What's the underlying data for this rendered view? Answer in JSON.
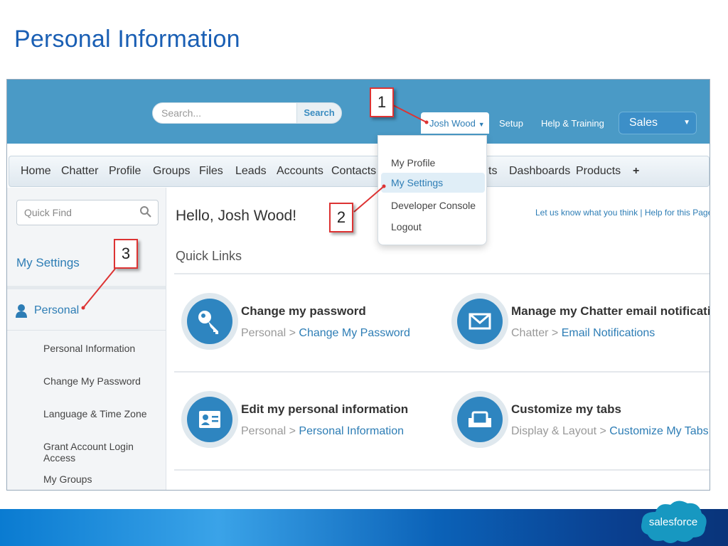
{
  "slide": {
    "title": "Personal Information"
  },
  "header": {
    "search_placeholder": "Search...",
    "search_button": "Search",
    "user_name": "Josh Wood",
    "setup": "Setup",
    "help_training": "Help & Training",
    "app_name": "Sales"
  },
  "tabs": [
    "Home",
    "Chatter",
    "Profile",
    "Groups",
    "Files",
    "Leads",
    "Accounts",
    "Contacts",
    "ts",
    "Dashboards",
    "Products",
    "+"
  ],
  "user_menu": [
    "My Profile",
    "My Settings",
    "Developer Console",
    "Logout"
  ],
  "sidebar": {
    "quickfind_placeholder": "Quick Find",
    "title": "My Settings",
    "section": "Personal",
    "items": [
      "Personal Information",
      "Change My Password",
      "Language & Time Zone",
      "Grant Account Login Access",
      "My Groups"
    ]
  },
  "main": {
    "greeting": "Hello, Josh Wood!",
    "feedback_link": "Let us know what you think",
    "separator": " | ",
    "help_link": "Help for this Page",
    "quick_links_title": "Quick Links",
    "links": [
      {
        "heading": "Change my password",
        "path_prefix": "Personal",
        "path_link": "Change My Password",
        "icon": "key-icon"
      },
      {
        "heading": "Manage my Chatter email notifications",
        "path_prefix": "Chatter",
        "path_link": "Email Notifications",
        "icon": "envelope-icon"
      },
      {
        "heading": "Edit my personal information",
        "path_prefix": "Personal",
        "path_link": "Personal Information",
        "icon": "id-card-icon"
      },
      {
        "heading": "Customize my tabs",
        "path_prefix": "Display & Layout",
        "path_link": "Customize My Tabs",
        "icon": "tabs-icon"
      }
    ],
    "path_sep": " > "
  },
  "callouts": [
    "1",
    "2",
    "3"
  ],
  "brand": {
    "logo_text": "salesforce"
  },
  "colors": {
    "accent": "#2d7db5",
    "header": "#4a9ac6",
    "callout_border": "#dd3333"
  }
}
